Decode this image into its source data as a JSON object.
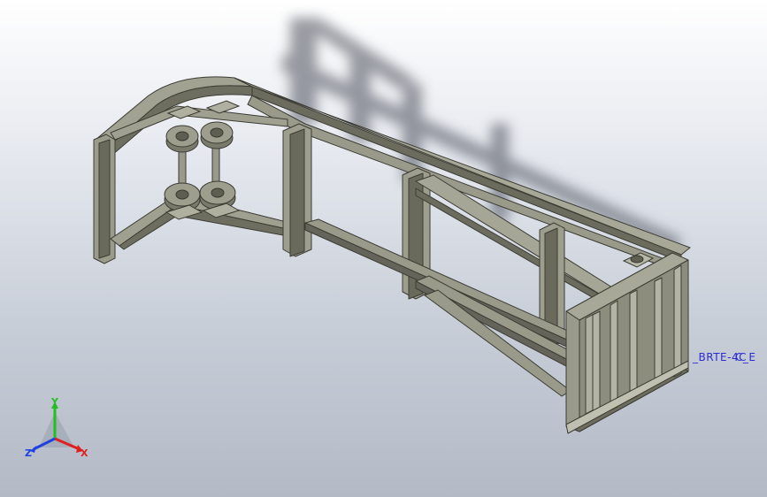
{
  "viewport": {
    "background_top": "#ffffff",
    "background_bottom": "#b3bac6"
  },
  "model": {
    "frame_color": "#8f8f80",
    "frame_dark": "#5e5e52",
    "frame_light": "#b4b4a4"
  },
  "annotation": {
    "text_1": "_BRTE-4C",
    "text_2": "C_E",
    "color": "#2b2bd6"
  },
  "triad": {
    "x_label": "X",
    "y_label": "Y",
    "z_label": "Z",
    "x_color": "#e02020",
    "y_color": "#20c020",
    "z_color": "#2040e0"
  }
}
